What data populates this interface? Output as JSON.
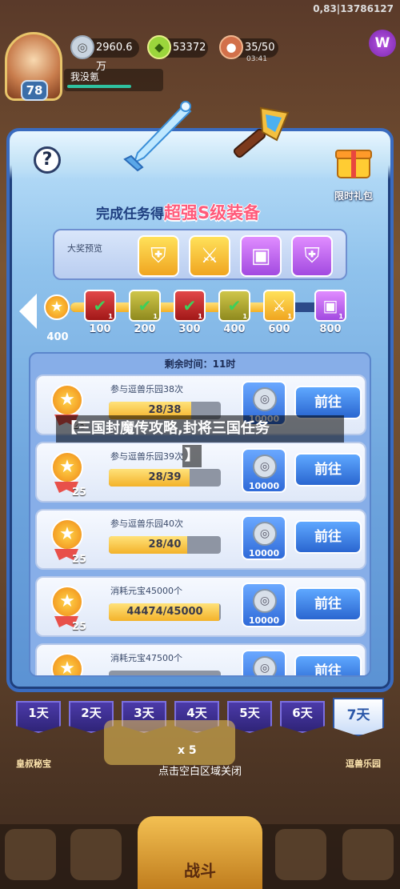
{
  "watermark": "0,83|13786127",
  "player": {
    "level": "78",
    "name": "我没氪"
  },
  "resources": {
    "coins": "2960.6万",
    "gems": "53372",
    "stamina": "35/50",
    "stamina_timer": "03:41"
  },
  "logo": "W",
  "panel": {
    "help": "?",
    "gift_label": "限时礼包",
    "title_prefix": "完成任务得",
    "title_highlight": "超强S级装备",
    "prize_label": "大奖预览",
    "current_stars": "400",
    "milestones": [
      {
        "value": "100",
        "count": "1",
        "style": "red"
      },
      {
        "value": "200",
        "count": "1",
        "style": "olive"
      },
      {
        "value": "300",
        "count": "1",
        "style": "red"
      },
      {
        "value": "400",
        "count": "1",
        "style": "olive"
      },
      {
        "value": "600",
        "count": "1",
        "style": "gold"
      },
      {
        "value": "800",
        "count": "1",
        "style": "purple"
      }
    ],
    "remaining_time": "剩余时间：11时",
    "tasks": [
      {
        "name": "参与逗兽乐园38次",
        "progress": "28/38",
        "fill": 0.737,
        "stars": "25",
        "reward": "10000",
        "button": "前往"
      },
      {
        "name": "参与逗兽乐园39次",
        "progress": "28/39",
        "fill": 0.718,
        "stars": "25",
        "reward": "10000",
        "button": "前往"
      },
      {
        "name": "参与逗兽乐园40次",
        "progress": "28/40",
        "fill": 0.7,
        "stars": "25",
        "reward": "10000",
        "button": "前往"
      },
      {
        "name": "消耗元宝45000个",
        "progress": "44474/45000",
        "fill": 0.988,
        "stars": "25",
        "reward": "10000",
        "button": "前往"
      },
      {
        "name": "消耗元宝47500个",
        "progress": "",
        "fill": 0,
        "stars": "",
        "reward": "",
        "button": "前往"
      }
    ]
  },
  "caption": "【三国封魔传攻略,封将三国任务",
  "caption_end": "】",
  "days": [
    "1天",
    "2天",
    "3天",
    "4天",
    "5天",
    "6天",
    "7天"
  ],
  "active_day_index": 6,
  "close_hint": "点击空白区域关闭",
  "background": {
    "left_label": "皇叔秘宝",
    "right_label": "逗兽乐园",
    "multiplier": "x 5",
    "battle": "战斗"
  }
}
